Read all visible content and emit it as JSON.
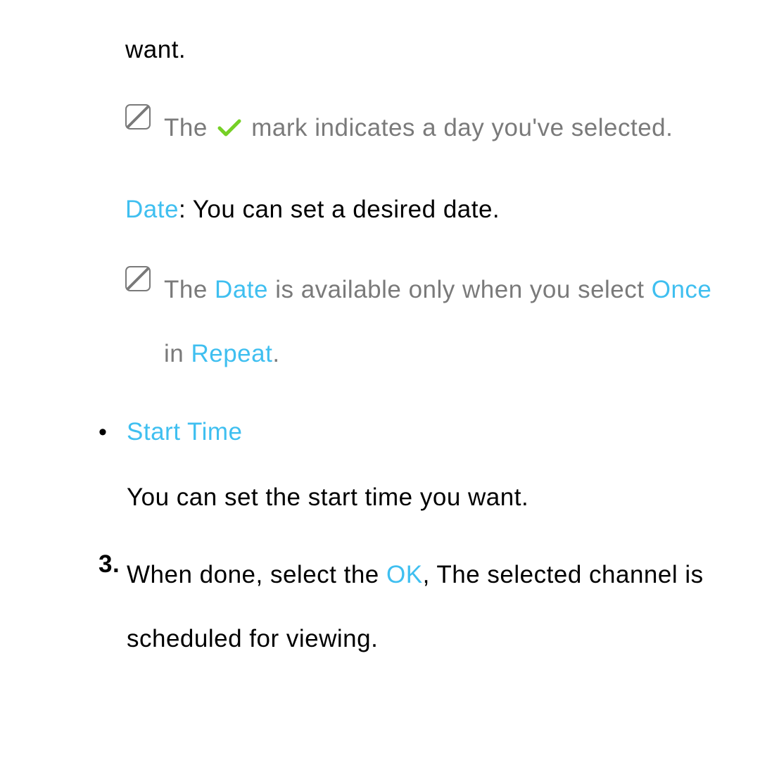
{
  "fragment": {
    "text": "want."
  },
  "note1": {
    "before_check": "The ",
    "after_check": " mark indicates a day you've selected."
  },
  "date_para": {
    "label": "Date",
    "rest": ": You can set a desired date."
  },
  "note2": {
    "t1": "The ",
    "t2": "Date",
    "t3": " is available only when you select ",
    "t4": "Once",
    "t5": " in ",
    "t6": "Repeat",
    "t7": "."
  },
  "start_time": {
    "heading": "Start Time",
    "desc": "You can set the start time you want."
  },
  "step3": {
    "number": "3.",
    "t1": "When done, select the ",
    "t2": "OK",
    "t3": ", The selected channel is scheduled for viewing."
  }
}
